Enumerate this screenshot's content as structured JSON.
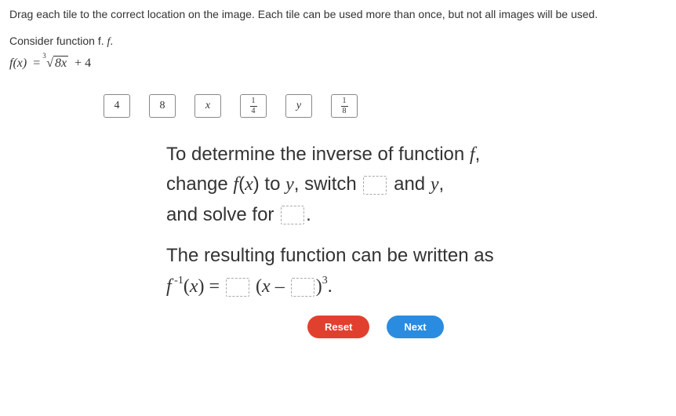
{
  "instructions": "Drag each tile to the correct location on the image. Each tile can be used more than once, but not all images will be used.",
  "prompt": "Consider function f.",
  "formula": {
    "lhs": "f(x)",
    "equals": "=",
    "root_index": "3",
    "radicand": "8x",
    "plus": "+ 4"
  },
  "tiles": {
    "t1": "4",
    "t2": "8",
    "t3": "x",
    "t4_num": "1",
    "t4_den": "4",
    "t5": "y",
    "t6_num": "1",
    "t6_den": "8"
  },
  "passage": {
    "line1a": "To determine the inverse of function ",
    "line1b": "f",
    "line1c": ",",
    "line2a": "change ",
    "line2b": "f",
    "line2c": "(",
    "line2d": "x",
    "line2e": ") to ",
    "line2f": "y",
    "line2g": ", switch ",
    "line2h": " and ",
    "line2i": "y",
    "line2j": ",",
    "line3a": "and solve for ",
    "line3b": ".",
    "line4": "The resulting function can be written as",
    "inv_f": "f",
    "inv_super": " -1",
    "inv_open": "(",
    "inv_x1": "x",
    "inv_close": ") = ",
    "inv_paren_open": "(",
    "inv_x2": "x",
    "inv_minus": " – ",
    "inv_paren_close": ")",
    "inv_cube": "3",
    "inv_period": "."
  },
  "buttons": {
    "reset": "Reset",
    "next": "Next"
  }
}
